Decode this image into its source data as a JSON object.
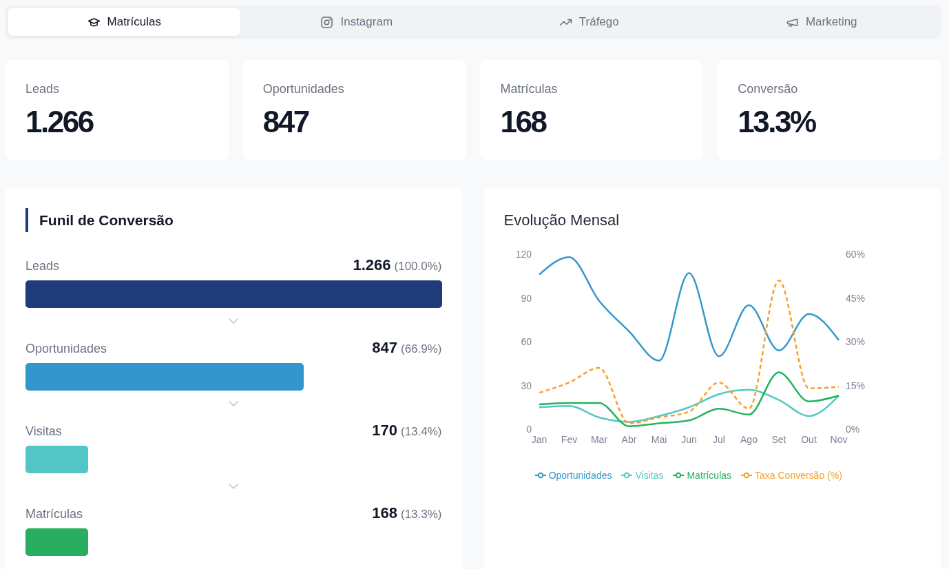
{
  "tabs": [
    {
      "label": "Matrículas",
      "selected": true
    },
    {
      "label": "Instagram",
      "selected": false
    },
    {
      "label": "Tráfego",
      "selected": false
    },
    {
      "label": "Marketing",
      "selected": false
    }
  ],
  "kpis": [
    {
      "label": "Leads",
      "value": "1.266"
    },
    {
      "label": "Oportunidades",
      "value": "847"
    },
    {
      "label": "Matrículas",
      "value": "168"
    },
    {
      "label": "Conversão",
      "value": "13.3%"
    }
  ],
  "funnel": {
    "title": "Funil de Conversão",
    "stages": [
      {
        "name": "Leads",
        "count": "1.266",
        "percent": "(100.0%)",
        "level": 1,
        "color": "#1f3b7a"
      },
      {
        "name": "Oportunidades",
        "count": "847",
        "percent": "(66.9%)",
        "level": 0.668,
        "color": "#3396cc"
      },
      {
        "name": "Visitas",
        "count": "170",
        "percent": "(13.4%)",
        "level": 0.15,
        "color": "#52c6c6"
      },
      {
        "name": "Matrículas",
        "count": "168",
        "percent": "(13.3%)",
        "level": 0.15,
        "color": "#27ae5f"
      }
    ]
  },
  "monthly_chart": {
    "title": "Evolução Mensal",
    "chart_data": {
      "type": "line",
      "categories": [
        "Jan",
        "Fev",
        "Mar",
        "Abr",
        "Mai",
        "Jun",
        "Jul",
        "Ago",
        "Set",
        "Out",
        "Nov"
      ],
      "ylim": [
        0,
        120
      ],
      "yticks": [
        0,
        30,
        60,
        90,
        120
      ],
      "y2lim": [
        0,
        60
      ],
      "y2ticks": [
        {
          "value": 0,
          "label": "0%"
        },
        {
          "value": 15,
          "label": "15%"
        },
        {
          "value": 30,
          "label": "30%"
        },
        {
          "value": 45,
          "label": "45%"
        },
        {
          "value": 60,
          "label": "60%"
        }
      ],
      "series": [
        {
          "name": "Oportunidades",
          "color": "#3399cc",
          "line_style": "solid",
          "values": [
            106,
            118,
            88,
            67,
            47,
            107,
            50,
            85,
            54,
            79,
            61
          ]
        },
        {
          "name": "Visitas",
          "color": "#55c7c5",
          "line_style": "solid",
          "values": [
            15,
            16,
            8,
            5,
            9,
            15,
            24,
            27,
            20,
            9,
            23
          ]
        },
        {
          "name": "Matrículas",
          "color": "#22b35e",
          "line_style": "solid",
          "values": [
            17,
            18,
            18,
            2,
            4,
            6,
            14,
            10,
            39,
            19,
            23
          ]
        },
        {
          "name": "Taxa Conversão (%)",
          "color": "#f5a02a",
          "axis": "y2",
          "line_style": "dashed",
          "values": [
            12.5,
            16,
            21,
            2,
            4,
            6,
            16,
            7,
            51,
            14,
            14.5
          ]
        }
      ]
    }
  }
}
